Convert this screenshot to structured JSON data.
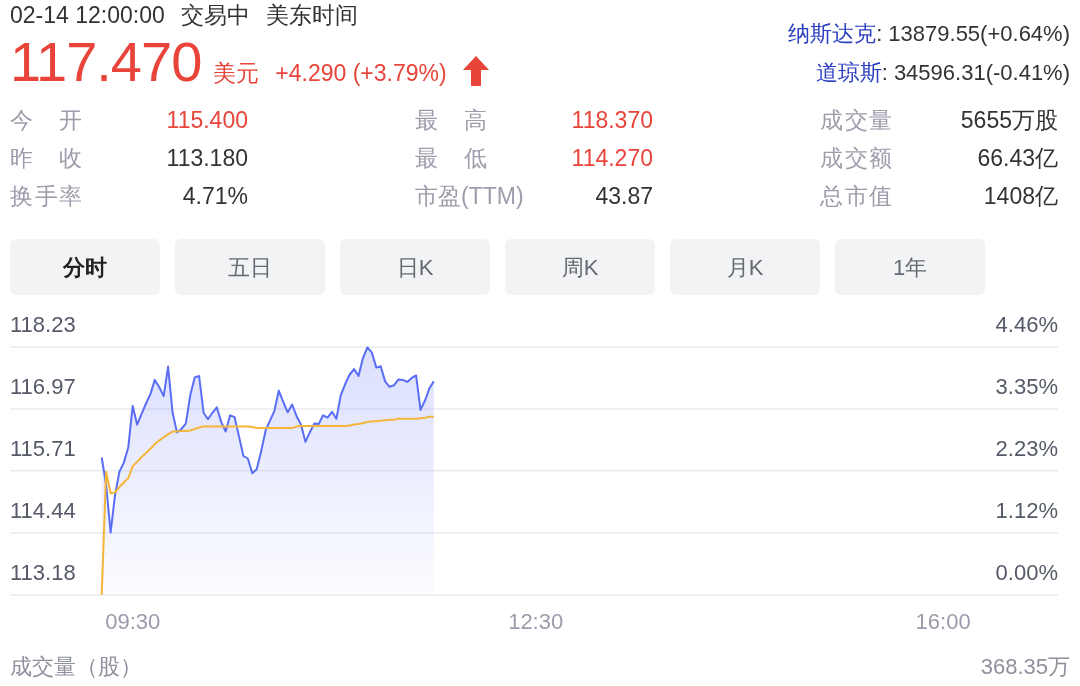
{
  "quote": {
    "datetime": "02-14 12:00:00",
    "status": "交易中",
    "timezone": "美东时间",
    "price": "117.470",
    "currency": "美元",
    "change": "+4.290 (+3.79%)",
    "rising": true
  },
  "indices": [
    {
      "name": "纳斯达克",
      "value": ": 13879.55(+0.64%)"
    },
    {
      "name": "道琼斯",
      "value": ": 34596.31(-0.41%)"
    }
  ],
  "stats": [
    {
      "label": "今 开",
      "value": "115.400",
      "color": "#e8443a"
    },
    {
      "label": "最 高",
      "value": "118.370",
      "color": "#e8443a"
    },
    {
      "label": "成交量",
      "value": "5655万股",
      "color": "#333333"
    },
    {
      "label": "昨 收",
      "value": "113.180",
      "color": "#333333"
    },
    {
      "label": "最 低",
      "value": "114.270",
      "color": "#e8443a"
    },
    {
      "label": "成交额",
      "value": "66.43亿",
      "color": "#333333"
    },
    {
      "label": "换手率",
      "value": "4.71%",
      "color": "#333333"
    },
    {
      "label": "市盈(TTM)",
      "value": "43.87",
      "color": "#333333"
    },
    {
      "label": "总市值",
      "value": "1408亿",
      "color": "#333333"
    }
  ],
  "tabs": [
    {
      "label": "分时",
      "selected": true
    },
    {
      "label": "五日",
      "selected": false
    },
    {
      "label": "日K",
      "selected": false
    },
    {
      "label": "周K",
      "selected": false
    },
    {
      "label": "月K",
      "selected": false
    },
    {
      "label": "1年",
      "selected": false
    }
  ],
  "chart": {
    "chart_data": {
      "type": "line",
      "grid": true,
      "categories": [
        null,
        null,
        null,
        null,
        null,
        null,
        null,
        "09:30",
        null,
        null,
        null,
        null,
        null,
        null,
        null,
        null,
        null,
        null,
        null,
        null,
        null,
        null,
        null,
        null,
        null,
        null,
        null,
        null,
        null,
        null,
        null,
        null,
        null,
        null,
        null,
        null,
        null,
        null,
        null,
        null,
        null,
        null,
        null,
        null,
        null,
        null,
        null,
        null,
        null,
        null,
        null,
        null,
        null,
        null,
        null,
        null,
        null,
        null,
        null,
        null,
        null,
        null,
        null,
        null,
        null,
        null,
        null,
        null,
        null,
        null,
        null,
        null,
        null,
        null,
        null,
        null,
        null,
        null,
        null,
        null,
        null,
        null,
        null,
        null,
        null,
        null,
        null,
        null,
        null,
        null,
        null,
        null,
        null,
        null,
        null,
        null,
        null,
        null,
        "12:30",
        null,
        null,
        null,
        null,
        null,
        null,
        null,
        null,
        null,
        null,
        null,
        null,
        null,
        null,
        null,
        null,
        null,
        null,
        null,
        null,
        null,
        null,
        null,
        null,
        null,
        null,
        null,
        null,
        null,
        null,
        null,
        null,
        null,
        null,
        null,
        null,
        null,
        null,
        null,
        null,
        null,
        null,
        null,
        null,
        null,
        null,
        null,
        null,
        null,
        null,
        null,
        null,
        null,
        null,
        null,
        null,
        null,
        null,
        null,
        null,
        null,
        null,
        null,
        null,
        null,
        null,
        null,
        null,
        null,
        null,
        null,
        null,
        null,
        null,
        null,
        null,
        null,
        null,
        null,
        null,
        null,
        null,
        null,
        null,
        null,
        null,
        null,
        null,
        null,
        null,
        null,
        "16:00"
      ],
      "series": [
        {
          "color": "#5a6ef5",
          "values": [
            115.98,
            115.43,
            114.45,
            115.21,
            115.69,
            115.87,
            116.19,
            117.03,
            116.65,
            116.87,
            117.08,
            117.27,
            117.56,
            117.41,
            117.23,
            117.83,
            116.89,
            116.49,
            116.56,
            116.67,
            117.25,
            117.61,
            117.64,
            116.89,
            116.76,
            116.89,
            117.0,
            116.7,
            116.51,
            116.84,
            116.8,
            116.41,
            116.01,
            115.96,
            115.66,
            115.74,
            116.1,
            116.53,
            116.73,
            116.93,
            117.34,
            117.11,
            116.9,
            117.06,
            116.82,
            116.65,
            116.3,
            116.49,
            116.67,
            116.66,
            116.84,
            116.79,
            116.91,
            116.77,
            117.25,
            117.48,
            117.67,
            117.78,
            117.64,
            118.01,
            118.22,
            118.12,
            117.81,
            117.84,
            117.53,
            117.42,
            117.45,
            117.57,
            117.56,
            117.52,
            117.6,
            117.65,
            116.95,
            117.14,
            117.39,
            117.53,
            null,
            null,
            null,
            null,
            null,
            null,
            null,
            null,
            null,
            null,
            null,
            null,
            null,
            null,
            null,
            null,
            null,
            null,
            null,
            null,
            null,
            null,
            null,
            null,
            null,
            null,
            null,
            null,
            null,
            null,
            null,
            null,
            null,
            null,
            null,
            null,
            null,
            null,
            null,
            null,
            null,
            null,
            null,
            null,
            null,
            null,
            null,
            null,
            null,
            null,
            null,
            null,
            null,
            null,
            null,
            null,
            null,
            null,
            null,
            null,
            null,
            null,
            null,
            null,
            null,
            null,
            null,
            null,
            null,
            null,
            null,
            null,
            null,
            null,
            null,
            null,
            null,
            null,
            null,
            null,
            null,
            null,
            null,
            null,
            null,
            null,
            null,
            null,
            null,
            null,
            null,
            null,
            null,
            null,
            null,
            null,
            null,
            null,
            null,
            null,
            null,
            null,
            null,
            null,
            null,
            null,
            null,
            null,
            null,
            null,
            null,
            null,
            null,
            null,
            null
          ]
        },
        {
          "color": "#f4b63a",
          "values": [
            113.18,
            115.69,
            115.25,
            115.27,
            115.38,
            115.47,
            115.56,
            115.8,
            115.89,
            115.99,
            116.07,
            116.16,
            116.25,
            116.33,
            116.39,
            116.45,
            116.51,
            116.51,
            116.52,
            116.52,
            116.53,
            116.56,
            116.59,
            116.61,
            116.61,
            116.61,
            116.61,
            116.61,
            116.61,
            116.61,
            116.61,
            116.61,
            116.61,
            116.61,
            116.6,
            116.58,
            116.58,
            116.58,
            116.58,
            116.58,
            116.58,
            116.58,
            116.58,
            116.58,
            116.61,
            116.62,
            116.62,
            116.62,
            116.62,
            116.62,
            116.62,
            116.62,
            116.62,
            116.62,
            116.62,
            116.62,
            116.63,
            116.65,
            116.66,
            116.68,
            116.7,
            116.72,
            116.72,
            116.73,
            116.74,
            116.75,
            116.75,
            116.77,
            116.77,
            116.77,
            116.77,
            116.77,
            116.78,
            116.79,
            116.81,
            116.81,
            null,
            null,
            null,
            null,
            null,
            null,
            null,
            null,
            null,
            null,
            null,
            null,
            null,
            null,
            null,
            null,
            null,
            null,
            null,
            null,
            null,
            null,
            null,
            null,
            null,
            null,
            null,
            null,
            null,
            null,
            null,
            null,
            null,
            null,
            null,
            null,
            null,
            null,
            null,
            null,
            null,
            null,
            null,
            null,
            null,
            null,
            null,
            null,
            null,
            null,
            null,
            null,
            null,
            null,
            null,
            null,
            null,
            null,
            null,
            null,
            null,
            null,
            null,
            null,
            null,
            null,
            null,
            null,
            null,
            null,
            null,
            null,
            null,
            null,
            null,
            null,
            null,
            null,
            null,
            null,
            null,
            null,
            null,
            null,
            null,
            null,
            null,
            null,
            null,
            null,
            null,
            null,
            null,
            null,
            null,
            null,
            null,
            null,
            null,
            null,
            null,
            null,
            null,
            null,
            null,
            null,
            null,
            null,
            null,
            null,
            null,
            null,
            null,
            null,
            null
          ]
        }
      ],
      "ylim": [
        113.18,
        118.23
      ],
      "yticks": [
        {
          "value": 118.23,
          "label": "118.23"
        },
        {
          "value": 116.97,
          "label": "116.97"
        },
        {
          "value": 115.71,
          "label": "115.71"
        },
        {
          "value": 114.44,
          "label": "114.44"
        },
        {
          "value": 113.18,
          "label": "113.18"
        }
      ]
    },
    "change_axis_labels": [
      "4.46%",
      "3.35%",
      "2.23%",
      "1.12%",
      "0.00%"
    ]
  },
  "volume": {
    "label": "成交量（股）",
    "value": "368.35万"
  }
}
